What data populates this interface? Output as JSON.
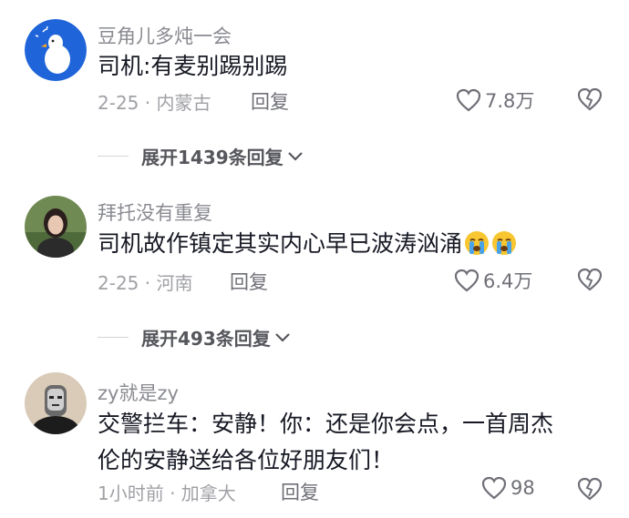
{
  "comments": [
    {
      "author": "豆角儿多炖一会",
      "text": "司机:有麦别踢别踢",
      "meta": "2-25 · 内蒙古",
      "reply_label": "回复",
      "likes": "7.8万",
      "expand_label": "展开1439条回复"
    },
    {
      "author": "拜托没有重复",
      "text": "司机故作镇定其实内心早已波涛汹涌",
      "meta": "2-25 · 河南",
      "reply_label": "回复",
      "likes": "6.4万",
      "expand_label": "展开493条回复"
    },
    {
      "author": "zy就是zy",
      "text_line1": "交警拦车：安静！你：还是你会点，一首周杰",
      "text_line2": "伦的安静送给各位好朋友们！",
      "meta": "1小时前 · 加拿大",
      "reply_label": "回复",
      "likes": "98"
    }
  ],
  "colors": {
    "avatar1_bg": "#1f64d8",
    "text_primary": "#161823",
    "text_secondary": "#8a8b91"
  }
}
